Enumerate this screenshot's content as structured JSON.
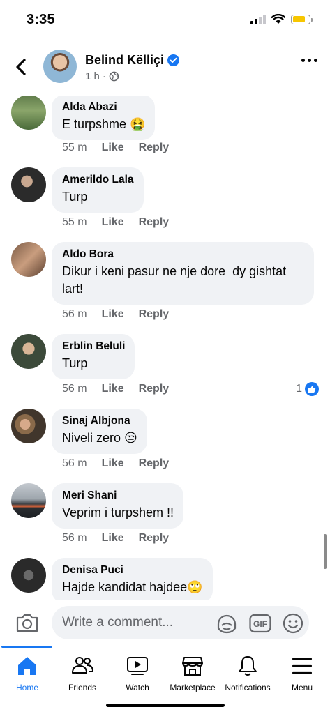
{
  "status_bar": {
    "time": "3:35",
    "battery_color": "#f7c600"
  },
  "post_header": {
    "author": "Belind Këlliçi",
    "verified": true,
    "time": "1 h",
    "privacy_icon": "globe-icon"
  },
  "colors": {
    "accent": "#1877f2",
    "bubble": "#f0f2f5",
    "meta": "#65676b"
  },
  "comments": [
    {
      "name": "Alda Abazi",
      "text": "E turpshme 🤮",
      "time": "55 m",
      "like": "Like",
      "reply": "Reply"
    },
    {
      "name": "Amerildo Lala",
      "text": "Turp",
      "time": "55 m",
      "like": "Like",
      "reply": "Reply"
    },
    {
      "name": "Aldo Bora",
      "text": "Dikur i keni pasur ne nje dore  dy gishtat\nlart!",
      "time": "56 m",
      "like": "Like",
      "reply": "Reply"
    },
    {
      "name": "Erblin Beluli",
      "text": "Turp",
      "time": "56 m",
      "like": "Like",
      "reply": "Reply",
      "reactions": "1"
    },
    {
      "name": "Sinaj Albjona",
      "text": "Niveli zero 😒",
      "time": "56 m",
      "like": "Like",
      "reply": "Reply"
    },
    {
      "name": "Meri Shani",
      "text": "Veprim i turpshem !!",
      "time": "56 m",
      "like": "Like",
      "reply": "Reply"
    },
    {
      "name": "Denisa Puci",
      "text": "Hajde kandidat hajdee🙄",
      "time": "",
      "like": "",
      "reply": ""
    }
  ],
  "composer": {
    "placeholder": "Write a comment..."
  },
  "nav": [
    {
      "label": "Home",
      "icon": "home-icon",
      "active": true
    },
    {
      "label": "Friends",
      "icon": "friends-icon"
    },
    {
      "label": "Watch",
      "icon": "watch-icon"
    },
    {
      "label": "Marketplace",
      "icon": "marketplace-icon"
    },
    {
      "label": "Notifications",
      "icon": "bell-icon"
    },
    {
      "label": "Menu",
      "icon": "menu-icon"
    }
  ]
}
